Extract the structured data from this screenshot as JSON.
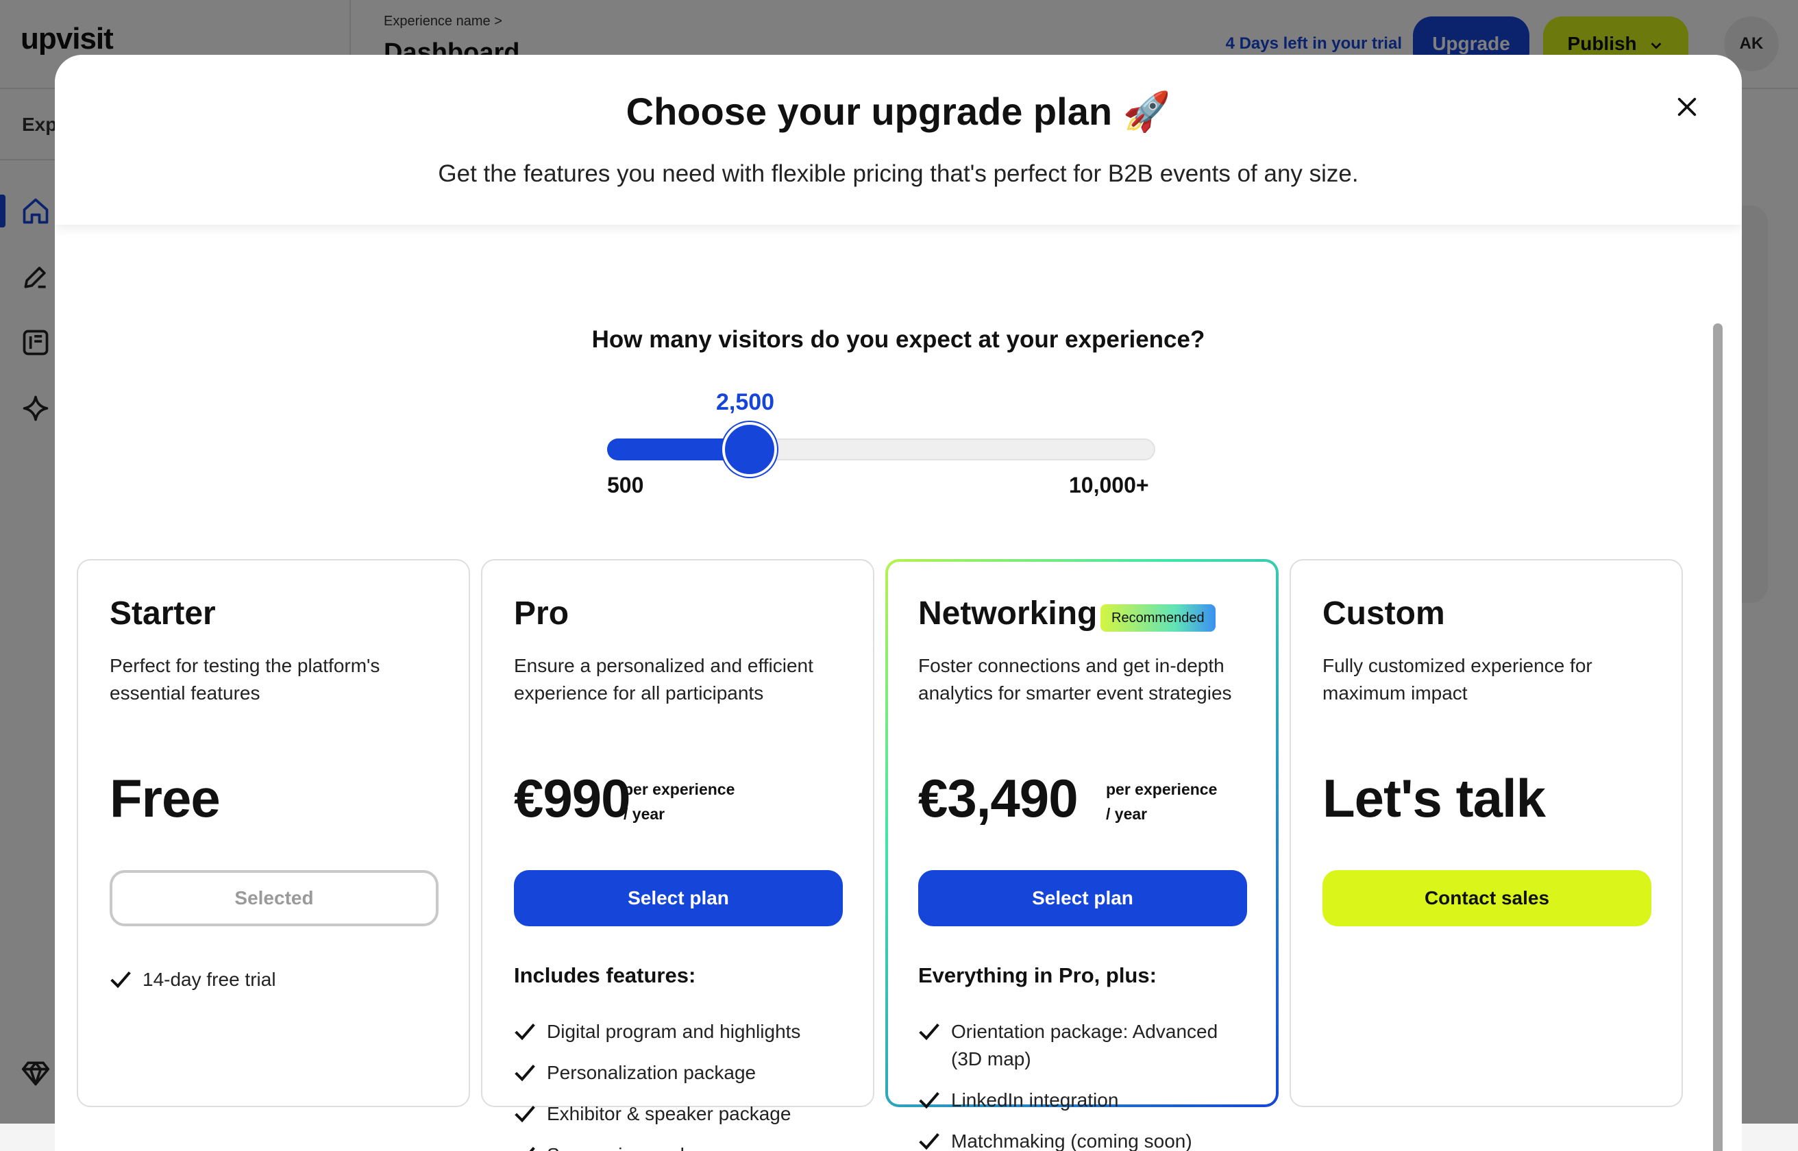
{
  "app": {
    "logo": "upvisit",
    "sidebar_section": "Exp",
    "breadcrumb": "Experience name >",
    "page_title": "Dashboard",
    "trial_text": "4 Days left in your trial",
    "upgrade_label": "Upgrade",
    "publish_label": "Publish",
    "avatar_initials": "AK",
    "accent_color": "#1645d9",
    "lime_color": "#d9f51a"
  },
  "modal": {
    "title": "Choose your upgrade plan 🚀",
    "subtitle": "Get the features you need with flexible pricing that's perfect for B2B events of any size.",
    "visitors_question": "How many visitors do you expect at your experience?",
    "slider": {
      "value_label": "2,500",
      "min_label": "500",
      "max_label": "10,000+",
      "fill_fraction": 0.26
    },
    "plans": [
      {
        "name": "Starter",
        "description": "Perfect for testing the platform's essential features",
        "price": "Free",
        "button_label": "Selected",
        "features": [
          "14-day free trial"
        ]
      },
      {
        "name": "Pro",
        "description": "Ensure a personalized and efficient experience for all participants",
        "price": "€990",
        "price_unit_line1": "per experience",
        "price_unit_line2": "/ year",
        "button_label": "Select plan",
        "features_title": "Includes features:",
        "features": [
          "Digital program and highlights",
          "Personalization package",
          "Exhibitor & speaker package",
          "Sponsoring package"
        ]
      },
      {
        "name": "Networking",
        "badge": "Recommended",
        "description": "Foster connections and get in-depth analytics for smarter event strategies",
        "price": "€3,490",
        "price_unit_line1": "per experience",
        "price_unit_line2": "/ year",
        "button_label": "Select plan",
        "features_title": "Everything in Pro, plus:",
        "features": [
          "Orientation package: Advanced (3D map)",
          "LinkedIn integration",
          "Matchmaking (coming soon)"
        ]
      },
      {
        "name": "Custom",
        "description": "Fully customized experience for maximum impact",
        "price": "Let's talk",
        "button_label": "Contact sales"
      }
    ]
  }
}
